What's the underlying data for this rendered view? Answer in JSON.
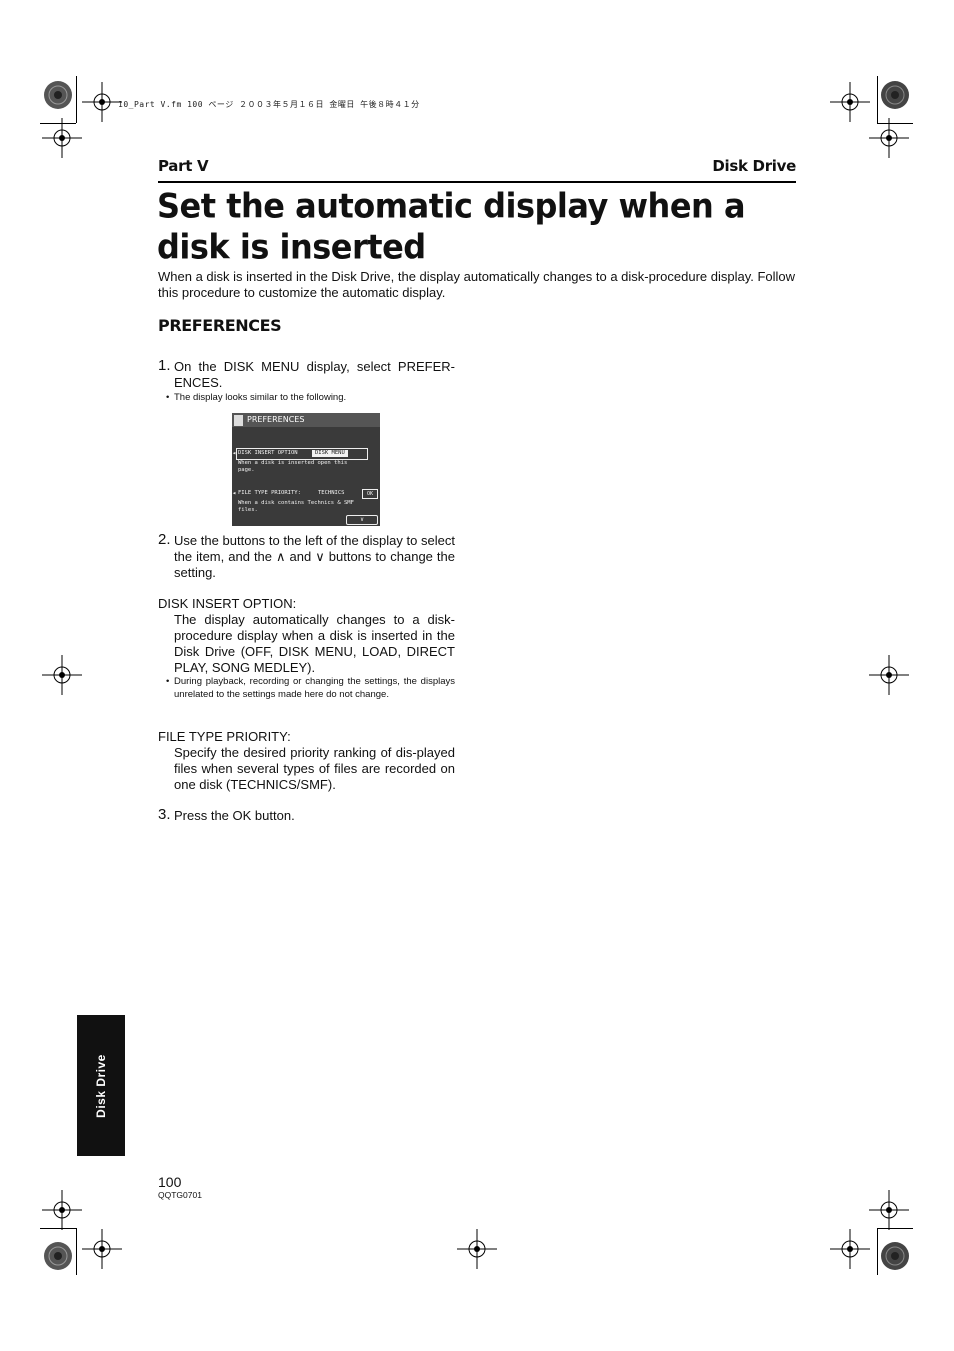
{
  "print_marks": {
    "file_stamp": "10_Part V.fm  100 ページ  ２００３年５月１６日  金曜日  午後８時４１分"
  },
  "header": {
    "part": "Part V",
    "chapter": "Disk Drive"
  },
  "title": "Set the automatic display when a disk is inserted",
  "intro": "When a disk is inserted in the Disk Drive, the display automatically changes to a disk-procedure display. Follow this procedure to customize the automatic display.",
  "section_heading": "PREFERENCES",
  "steps": {
    "s1_num": "1.",
    "s1_text": "On the DISK MENU display, select PREFER-ENCES.",
    "s1_note": "The display looks similar to the following.",
    "s2_num": "2.",
    "s2_text": "Use the buttons to the left of the display to select the item, and the ∧ and ∨ buttons to change the setting.",
    "s3_num": "3.",
    "s3_text": "Press the OK button."
  },
  "options": {
    "o1_label": "DISK INSERT OPTION:",
    "o1_desc": "The display automatically changes to a disk-procedure display when a disk is inserted in the Disk Drive (OFF, DISK MENU, LOAD, DIRECT PLAY, SONG MEDLEY).",
    "o1_note": "During playback, recording or changing the settings, the displays unrelated to the settings made here do not change.",
    "o2_label": "FILE TYPE PRIORITY:",
    "o2_desc": "Specify the desired priority ranking of dis-played files when several types of files are recorded on one disk (TECHNICS/SMF)."
  },
  "lcd": {
    "title": "PREFERENCES",
    "row1_label": "DISK INSERT OPTION",
    "row1_value": "DISK MENU",
    "row1_help1": "When a disk is inserted open this",
    "row1_help2": "page.",
    "row2_label": "FILE TYPE PRIORITY:",
    "row2_value": "TECHNICS",
    "row2_help1": "When a disk contains Technics & SMF",
    "row2_help2": "files.",
    "ok": "OK",
    "down": "∨"
  },
  "side_tab": "Disk Drive",
  "footer": {
    "page_number": "100",
    "doc_code": "QQTG0701"
  }
}
